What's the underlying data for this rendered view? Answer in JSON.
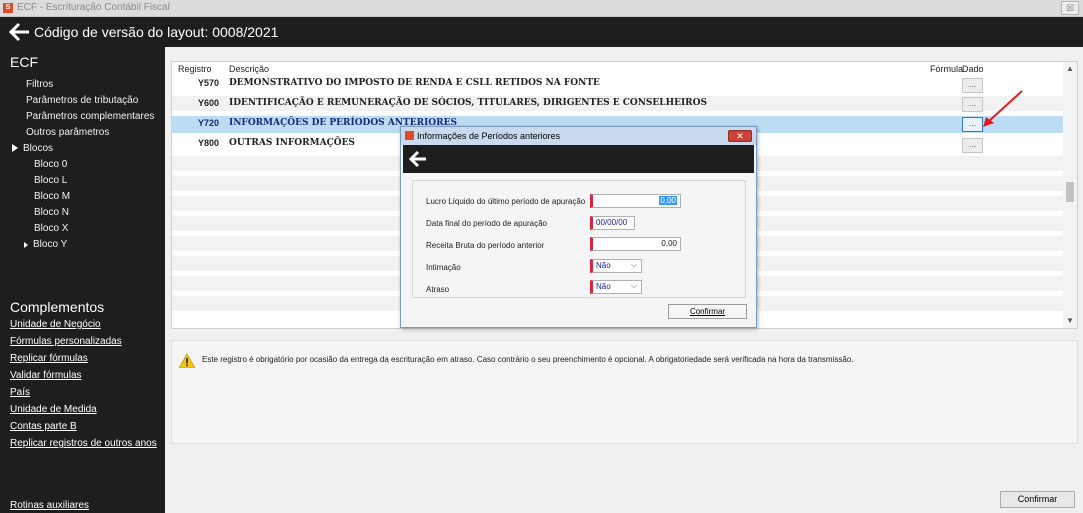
{
  "window": {
    "title": "ECF - Escrituração Contábil Fiscal",
    "close_glyph": "☒"
  },
  "header": {
    "title": "Código de versão do layout: 0008/2021"
  },
  "sidebar": {
    "ecf_title": "ECF",
    "items": [
      {
        "label": "Filtros"
      },
      {
        "label": "Parâmetros de tributação"
      },
      {
        "label": "Parâmetros complementares"
      },
      {
        "label": "Outros parâmetros"
      }
    ],
    "blocos_label": "Blocos",
    "blocos": [
      "Bloco 0",
      "Bloco L",
      "Bloco M",
      "Bloco N",
      "Bloco X",
      "Bloco Y"
    ],
    "complementos_title": "Complementos",
    "links": [
      "Unidade de Negócio",
      "Fórmulas personalizadas",
      "Replicar fórmulas",
      "Validar fórmulas",
      "País",
      "Unidade de Medida",
      "Contas parte B",
      "Replicar registros de outros anos"
    ],
    "rotinas": "Rotinas auxiliares"
  },
  "table": {
    "headers": {
      "registro": "Registro",
      "descricao": "Descrição",
      "formula": "Fórmula",
      "dado": "Dado"
    },
    "rows": [
      {
        "code": "Y570",
        "desc": "DEMONSTRATIVO DO IMPOSTO DE RENDA E CSLL RETIDOS NA FONTE",
        "btn": "..."
      },
      {
        "code": "Y600",
        "desc": "IDENTIFICAÇÃO E REMUNERAÇÃO DE SÓCIOS, TITULARES, DIRIGENTES E CONSELHEIROS",
        "btn": "..."
      },
      {
        "code": "Y720",
        "desc": "INFORMAÇÕES DE PERÍODOS ANTERIORES",
        "btn": "..."
      },
      {
        "code": "Y800",
        "desc": "OUTRAS INFORMAÇÕES",
        "btn": "..."
      }
    ],
    "selected_index": 2
  },
  "info": {
    "message": "Este registro é obrigatório por ocasião da entrega da escrituração em atraso. Caso contrário o seu preenchimento é opcional. A obrigatoriedade será verificada na hora da transmissão."
  },
  "bottom": {
    "confirm_label": "Confirmar"
  },
  "dialog": {
    "title": "Informações de Períodos anteriores",
    "close_glyph": "✕",
    "fields": {
      "lucro": {
        "label": "Lucro Líquido do último período de apuração",
        "value": "0,00"
      },
      "data_final": {
        "label": "Data final do período de apuração",
        "value": "00/00/00"
      },
      "receita": {
        "label": "Receita Bruta do período anterior",
        "value": "0,00"
      },
      "intimacao": {
        "label": "Intimação",
        "value": "Não"
      },
      "atraso": {
        "label": "Atraso",
        "value": "Não"
      }
    },
    "confirm_label": "Confirmar"
  },
  "colors": {
    "accent_red": "#d7263d",
    "selection": "#bcdcf4",
    "dark_bg": "#1e1e1e"
  },
  "icons": [
    "back-arrow-icon",
    "warning-icon",
    "expand-triangle-icon",
    "chevron-down-icon",
    "close-icon",
    "annotation-arrow-icon"
  ]
}
